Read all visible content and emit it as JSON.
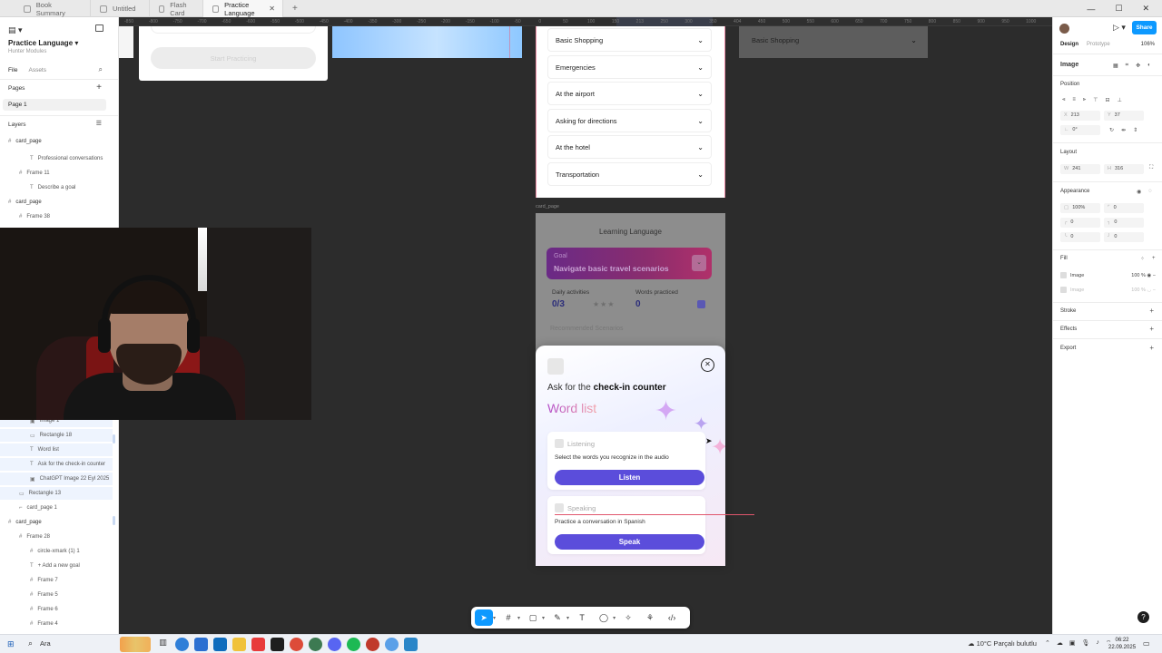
{
  "browser": {
    "tabs": [
      {
        "label": "Book Summary"
      },
      {
        "label": "Untitled"
      },
      {
        "label": "Flash Card"
      },
      {
        "label": "Practice Language"
      }
    ],
    "new_tab": "+"
  },
  "left_panel": {
    "file_title": "Practice Language",
    "file_subtitle": "Hunter Modules",
    "tab_file": "File",
    "tab_assets": "Assets",
    "pages_heading": "Pages",
    "current_page": "Page 1",
    "layers_heading": "Layers",
    "layers_top": [
      {
        "label": "card_page",
        "kind": "frame"
      },
      {
        "label": "Professional conversations",
        "kind": "text"
      },
      {
        "label": "Frame 11",
        "kind": "frame"
      },
      {
        "label": "Describe a goal",
        "kind": "text"
      },
      {
        "label": "card_page",
        "kind": "frame"
      },
      {
        "label": "Frame 38",
        "kind": "frame"
      }
    ],
    "layers_bottom": [
      {
        "label": "Image 1",
        "kind": "image"
      },
      {
        "label": "Rectangle 18",
        "kind": "rect"
      },
      {
        "label": "Word list",
        "kind": "text"
      },
      {
        "label": "Ask for the check-in counter",
        "kind": "text"
      },
      {
        "label": "ChatGPT Image 22 Eyl 2025",
        "kind": "image"
      },
      {
        "label": "Rectangle 13",
        "kind": "rect"
      },
      {
        "label": "card_page 1",
        "kind": "frame"
      },
      {
        "label": "card_page",
        "kind": "frame"
      },
      {
        "label": "Frame 28",
        "kind": "frame"
      },
      {
        "label": "circle-xmark (1) 1",
        "kind": "frame"
      },
      {
        "label": "+ Add a new goal",
        "kind": "text"
      },
      {
        "label": "Frame 7",
        "kind": "frame"
      },
      {
        "label": "Frame 5",
        "kind": "frame"
      },
      {
        "label": "Frame 6",
        "kind": "frame"
      },
      {
        "label": "Frame 4",
        "kind": "frame"
      }
    ]
  },
  "canvas": {
    "ruler_marks": [
      "-850",
      "-800",
      "-750",
      "-700",
      "-650",
      "-600",
      "-550",
      "-500",
      "-450",
      "-400",
      "-350",
      "-300",
      "-250",
      "-200",
      "-150",
      "-100",
      "-50",
      "0",
      "50",
      "100",
      "150",
      "213",
      "250",
      "300",
      "350",
      "404",
      "450",
      "500",
      "550",
      "600",
      "650",
      "700",
      "750",
      "800",
      "850",
      "900",
      "950",
      "1000"
    ],
    "start_practicing": "Start Practicing",
    "accordion_items": [
      "Basic Shopping",
      "Emergencies",
      "At the airport",
      "Asking for directions",
      "At the hotel",
      "Transportation"
    ],
    "ghost_item": "Basic Shopping",
    "frame_label": "card_page",
    "card_title": "Learning Language",
    "goal_label": "Goal",
    "goal_value": "Navigate basic travel scenarios",
    "daily_label": "Daily activities",
    "daily_value": "0/3",
    "words_label": "Words practiced",
    "words_value": "0",
    "recommended": "Recommended Scenarios",
    "modal": {
      "ask_prefix": "Ask for the",
      "ask_bold": "check-in counter",
      "word_list": "Word list",
      "listening_label": "Listening",
      "listening_desc": "Select the words you recognize in the audio",
      "listen_button": "Listen",
      "speaking_label": "Speaking",
      "speaking_desc": "Practice a conversation in Spanish",
      "speak_button": "Speak"
    }
  },
  "right_panel": {
    "share": "Share",
    "tab_design": "Design",
    "tab_prototype": "Prototype",
    "zoom": "106%",
    "selection_type": "Image",
    "position_heading": "Position",
    "x_label": "X",
    "x_value": "213",
    "y_label": "Y",
    "y_value": "37",
    "rotation_value": "0°",
    "layout_heading": "Layout",
    "w_label": "W",
    "w_value": "241",
    "h_label": "H",
    "h_value": "316",
    "appearance_heading": "Appearance",
    "opacity": "100%",
    "radius": "0",
    "fill_heading": "Fill",
    "fills": [
      {
        "label": "Image",
        "opacity": "100",
        "unit": "%"
      },
      {
        "label": "Image",
        "opacity": "100",
        "unit": "%"
      }
    ],
    "stroke_heading": "Stroke",
    "effects_heading": "Effects",
    "export_heading": "Export"
  },
  "taskbar": {
    "search_placeholder": "Ara",
    "weather": "10°C  Parçalı bulutlu",
    "time": "06:22",
    "date": "22.09.2025"
  },
  "help": "?"
}
